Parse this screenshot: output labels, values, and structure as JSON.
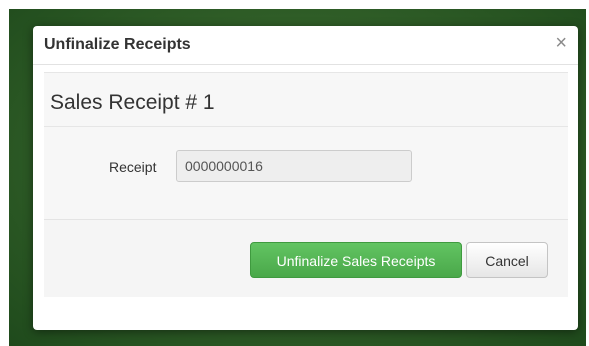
{
  "dialog": {
    "title": "Unfinalize Receipts",
    "close_icon": "close-icon",
    "close_glyph": "×"
  },
  "section": {
    "title": "Sales Receipt # 1",
    "receipt_label": "Receipt",
    "receipt_value": "0000000016"
  },
  "footer": {
    "primary_label": "Unfinalize Sales Receipts",
    "cancel_label": "Cancel"
  },
  "colors": {
    "primary_button": "#5cb85c",
    "background_frame": "#2f5d27"
  }
}
